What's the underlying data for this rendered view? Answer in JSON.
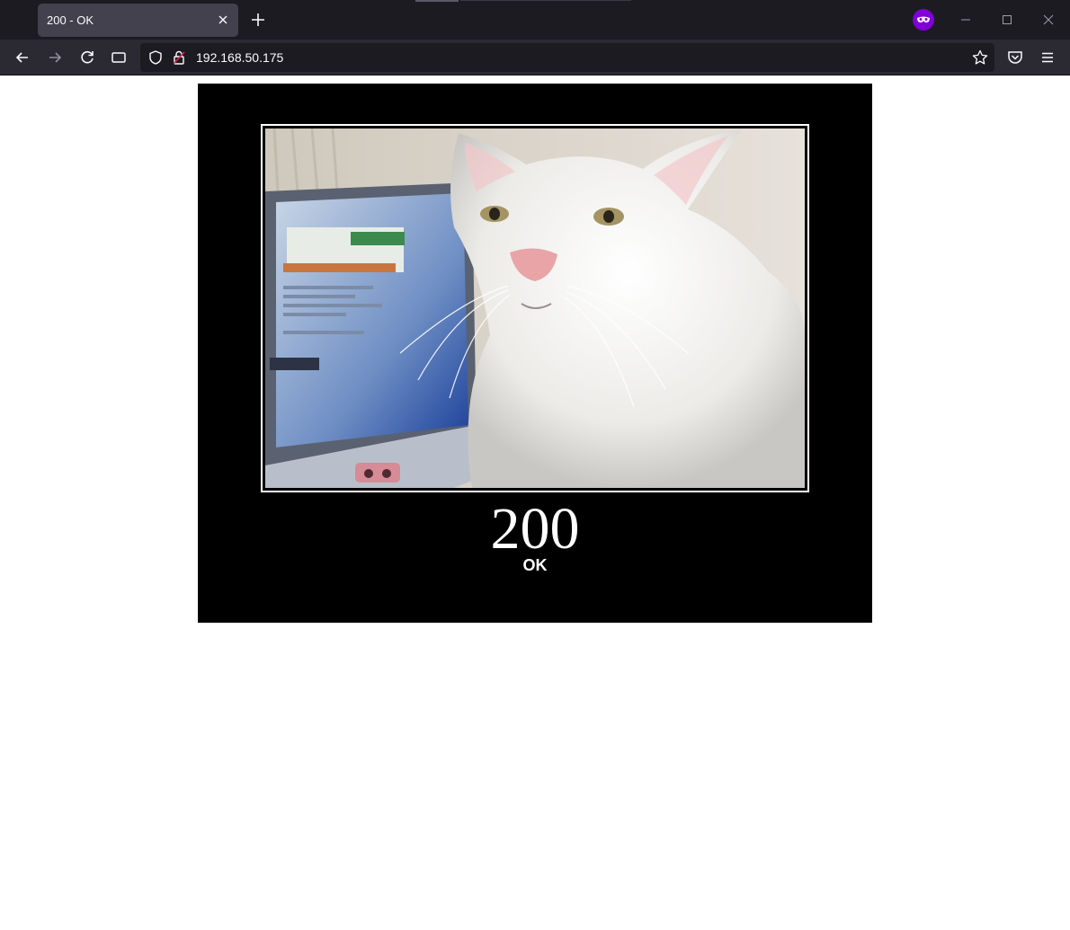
{
  "browser": {
    "tab": {
      "title": "200 - OK",
      "close_icon": "close-icon"
    },
    "new_tab_icon": "plus-icon",
    "private_browsing_icon": "private-mask-icon",
    "window_controls": [
      "minimize-icon",
      "maximize-icon",
      "close-icon"
    ],
    "nav": {
      "back_icon": "arrow-left-icon",
      "forward_icon": "arrow-right-icon",
      "reload_icon": "reload-icon",
      "reader_icon": "reader-view-icon",
      "pocket_icon": "pocket-icon",
      "menu_icon": "hamburger-menu-icon"
    },
    "urlbar": {
      "url": "192.168.50.175",
      "shield_icon": "tracking-shield-icon",
      "lock_icon": "insecure-lock-icon",
      "bookmark_icon": "star-icon"
    }
  },
  "page": {
    "status_code": "200",
    "status_text": "OK",
    "image_subject": "white cat next to laptop"
  },
  "colors": {
    "tab_strip_bg": "#1c1b22",
    "active_tab_bg": "#42414d",
    "navbar_bg": "#2b2a33",
    "poster_bg": "#000000",
    "private_accent": "#8000d7"
  }
}
